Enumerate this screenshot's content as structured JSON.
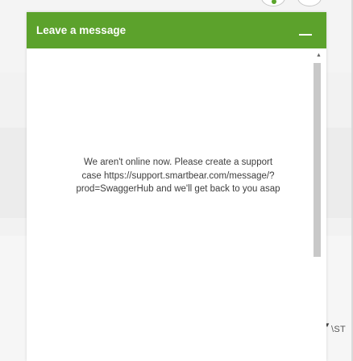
{
  "background": {
    "corner_text": "\\ST",
    "corner_caret": "▼"
  },
  "widget": {
    "title": "Leave a message",
    "minimize_label": "Minimize",
    "message_line1": "We aren't online now. Please create a support",
    "message_line2": "case https://support.smartbear.com/message/?",
    "message_line3": "prod=SwaggerHub and we'll get back to you asap",
    "scroll_up_glyph": "▲"
  },
  "colors": {
    "header_green": "#5ca22c",
    "scrollbar": "#c8c8c8",
    "text": "#3e3e3e"
  }
}
